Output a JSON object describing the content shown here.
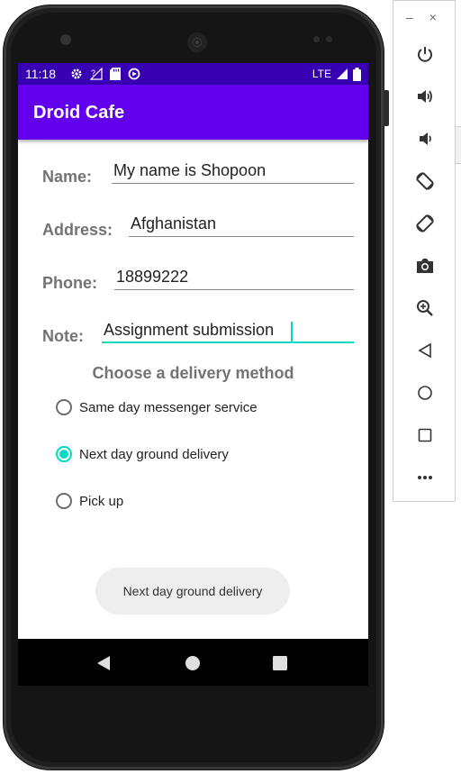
{
  "status_bar": {
    "time": "11:18",
    "network": "LTE",
    "icons": [
      "gear-icon",
      "signal-off-icon",
      "sd-card-icon",
      "sync-icon"
    ]
  },
  "app_bar": {
    "title": "Droid Cafe"
  },
  "form": {
    "name_label": "Name:",
    "name_value": "My name is Shopoon",
    "address_label": "Address:",
    "address_value": "Afghanistan",
    "phone_label": "Phone:",
    "phone_value": "18899222",
    "note_label": "Note:",
    "note_value": "Assignment submission"
  },
  "delivery": {
    "heading": "Choose a delivery method",
    "options": [
      {
        "label": "Same day messenger service",
        "checked": false
      },
      {
        "label": "Next day ground delivery",
        "checked": true
      },
      {
        "label": "Pick up",
        "checked": false
      }
    ]
  },
  "toast": {
    "text": "Next day ground delivery"
  },
  "colors": {
    "status_bar": "#3700b3",
    "app_bar": "#6200ee",
    "accent": "#03dac5",
    "label_gray": "#737373"
  },
  "emulator_toolbar": {
    "minimize": "–",
    "close": "×",
    "buttons": [
      "power-icon",
      "volume-up-icon",
      "volume-down-icon",
      "rotate-left-icon",
      "rotate-right-icon",
      "camera-icon",
      "zoom-icon",
      "back-icon",
      "home-icon",
      "overview-icon",
      "more-icon"
    ]
  }
}
